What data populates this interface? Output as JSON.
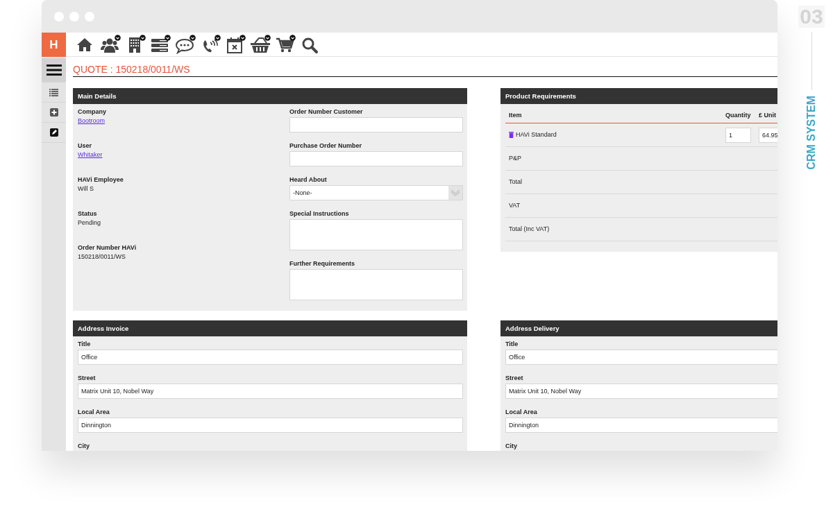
{
  "decor": {
    "number": "03",
    "label": "CRM SYSTEM"
  },
  "app": {
    "logo": "H"
  },
  "toolbar": [
    {
      "kind": "home",
      "dropdown": false
    },
    {
      "kind": "people",
      "dropdown": true
    },
    {
      "kind": "building",
      "dropdown": true
    },
    {
      "kind": "list",
      "dropdown": true
    },
    {
      "kind": "chat",
      "dropdown": true
    },
    {
      "kind": "phone",
      "dropdown": true
    },
    {
      "kind": "calendar",
      "dropdown": true
    },
    {
      "kind": "basket",
      "dropdown": true
    },
    {
      "kind": "cart",
      "dropdown": true
    },
    {
      "kind": "search",
      "dropdown": false
    }
  ],
  "sidebar": [
    {
      "kind": "menu",
      "selected": true
    },
    {
      "kind": "list",
      "selected": false
    },
    {
      "kind": "add",
      "selected": false
    },
    {
      "kind": "edit",
      "selected": false
    }
  ],
  "page_title": "QUOTE : 150218/0011/WS",
  "main_details": {
    "title": "Main Details",
    "info": [
      {
        "label": "Company",
        "value": "Bootroom",
        "kind": "link"
      },
      {
        "label": "User",
        "value": "Whitaker",
        "kind": "link"
      },
      {
        "label": "HAVi Employee",
        "value": "Will S",
        "kind": "text"
      },
      {
        "label": "Status",
        "value": "Pending",
        "kind": "text"
      },
      {
        "label": "Order Number HAVi",
        "value": "150218/0011/WS",
        "kind": "text"
      }
    ],
    "fields": [
      {
        "label": "Order Number Customer",
        "kind": "input"
      },
      {
        "label": "Purchase Order Number",
        "kind": "input"
      },
      {
        "label": "Heard About",
        "kind": "select",
        "value": "-None-"
      },
      {
        "label": "Special Instructions",
        "kind": "textarea"
      },
      {
        "label": "Further Requirements",
        "kind": "textarea"
      }
    ]
  },
  "product_requirements": {
    "title": "Product Requirements",
    "columns": [
      "Item",
      "Quantity",
      "£ Unit"
    ],
    "rows": [
      {
        "kind": "item",
        "item": "HAVi Standard",
        "quantity": "1",
        "unit": "64.95"
      },
      {
        "kind": "summary",
        "item": "P&P"
      },
      {
        "kind": "summary",
        "item": "Total"
      },
      {
        "kind": "summary",
        "item": "VAT"
      },
      {
        "kind": "summary",
        "item": "Total (Inc VAT)"
      }
    ]
  },
  "address_invoice": {
    "title": "Address Invoice",
    "fields": [
      {
        "label": "Title",
        "value": "Office"
      },
      {
        "label": "Street",
        "value": "Matrix Unit 10, Nobel Way"
      },
      {
        "label": "Local Area",
        "value": "Dinnington"
      },
      {
        "label": "City"
      }
    ]
  },
  "address_delivery": {
    "title": "Address Delivery",
    "fields": [
      {
        "label": "Title",
        "value": "Office"
      },
      {
        "label": "Street",
        "value": "Matrix Unit 10, Nobel Way"
      },
      {
        "label": "Local Area",
        "value": "Dinnington"
      },
      {
        "label": "City"
      }
    ]
  }
}
